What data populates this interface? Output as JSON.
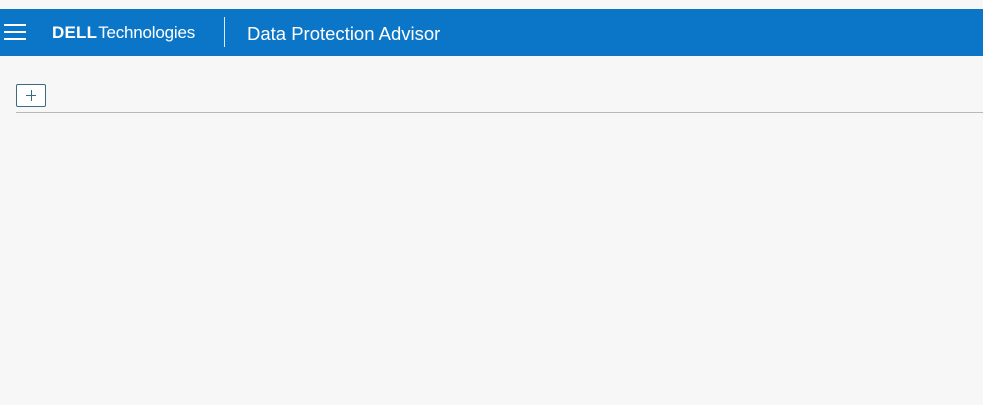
{
  "header": {
    "brand_dell": "DELL",
    "brand_technologies": "Technologies",
    "app_title": "Data Protection Advisor"
  },
  "colors": {
    "header_background": "#0b76c8",
    "page_background": "#f7f7f7",
    "add_button_border": "#3d6a80"
  },
  "icons": {
    "menu": "hamburger-menu-icon",
    "add": "plus-icon"
  }
}
